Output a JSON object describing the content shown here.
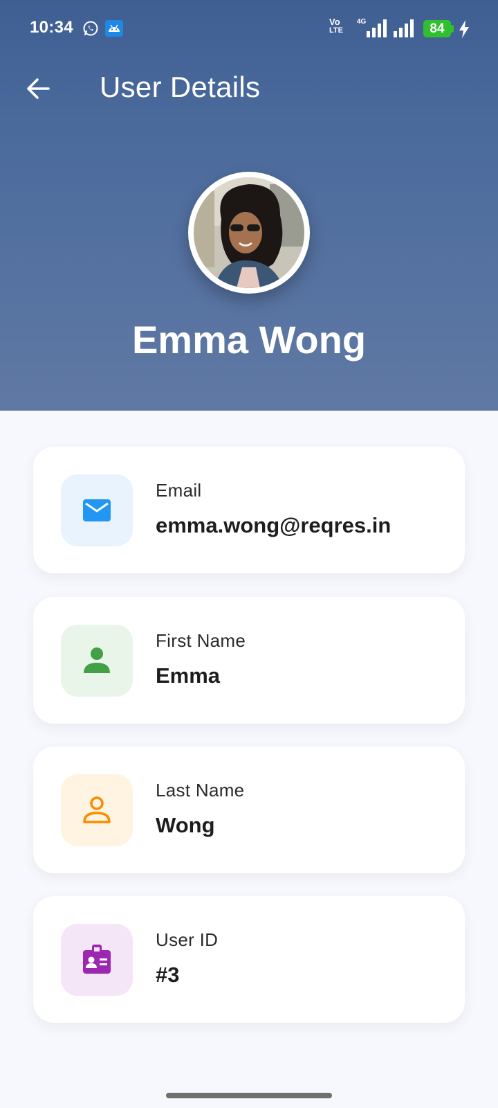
{
  "status_bar": {
    "time": "10:34",
    "battery": "84",
    "network": "4G",
    "volte": "Vo",
    "volte_sub": "LTE"
  },
  "header": {
    "title": "User Details",
    "user_name": "Emma Wong"
  },
  "details": [
    {
      "label": "Email",
      "value": "emma.wong@reqres.in",
      "icon": "mail-icon",
      "color": "#2196f3",
      "bg": "#e8f3fe"
    },
    {
      "label": "First Name",
      "value": "Emma",
      "icon": "person-icon",
      "color": "#43a047",
      "bg": "#eaf5ea"
    },
    {
      "label": "Last Name",
      "value": "Wong",
      "icon": "person-outline-icon",
      "color": "#fb8c00",
      "bg": "#fff3e2"
    },
    {
      "label": "User ID",
      "value": "#3",
      "icon": "badge-icon",
      "color": "#9c27b0",
      "bg": "#f4e6f6"
    }
  ],
  "colors": {
    "header_top": "#3f5f93",
    "header_bottom": "#6079a4",
    "background": "#f7f8fd"
  }
}
